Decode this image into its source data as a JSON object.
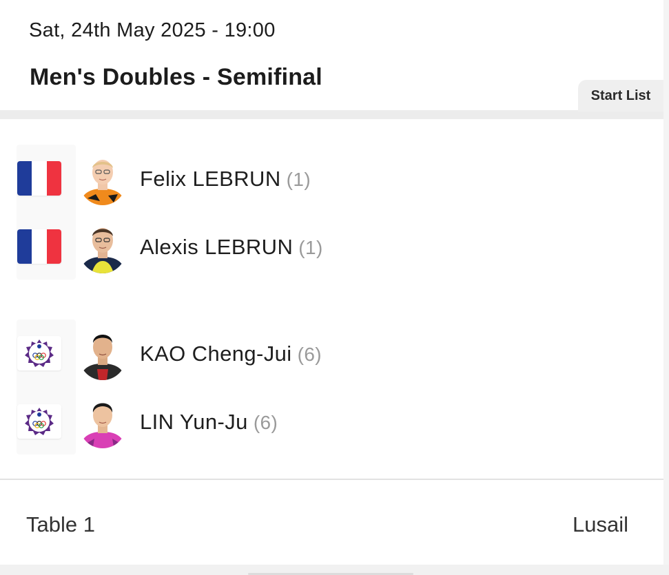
{
  "match": {
    "datetime": "Sat, 24th May 2025 - 19:00",
    "event_title": "Men's Doubles - Semifinal",
    "start_list_label": "Start List"
  },
  "teams": [
    {
      "country_flag": "flag-france-icon",
      "players": [
        {
          "name": "Felix LEBRUN",
          "seed": "(1)"
        },
        {
          "name": "Alexis LEBRUN",
          "seed": "(1)"
        }
      ]
    },
    {
      "country_flag": "flag-chinese-taipei-icon",
      "players": [
        {
          "name": "KAO Cheng-Jui",
          "seed": "(6)"
        },
        {
          "name": "LIN Yun-Ju",
          "seed": "(6)"
        }
      ]
    }
  ],
  "footer": {
    "table": "Table 1",
    "venue": "Lusail"
  },
  "colors": {
    "text": "#1e1e1e",
    "seed": "#9a9a9a",
    "tab_bg": "#efefef",
    "fr_blue": "#1f3c9a",
    "fr_red": "#ef3340",
    "tpe_purple": "#5b2a86"
  }
}
